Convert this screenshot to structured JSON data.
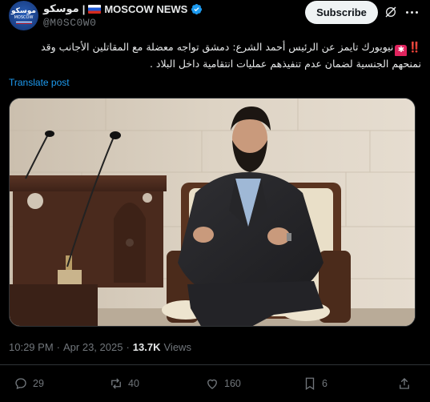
{
  "author": {
    "name_arabic": "موسكو",
    "separator": "|",
    "name_english": "MOSCOW NEWS",
    "handle": "@M0SC0W0",
    "avatar_text_top": "موسكو",
    "avatar_text_bottom": "MOSCOW"
  },
  "header": {
    "subscribe_label": "Subscribe"
  },
  "tweet": {
    "emoji_prefix": "‼️",
    "text": "نيويورك تايمز عن الرئيس أحمد الشرع: دمشق تواجه معضلة مع المقاتلين الأجانب وقد نمنحهم الجنسية لضمان عدم تنفيذهم عمليات انتقامية داخل البلاد ."
  },
  "translate_label": "Translate post",
  "meta": {
    "time": "10:29 PM",
    "dot": "·",
    "date": "Apr 23, 2025",
    "views_count": "13.7K",
    "views_label": "Views"
  },
  "actions": {
    "replies": "29",
    "reposts": "40",
    "likes": "160",
    "bookmarks": "6"
  },
  "colors": {
    "background": "#000000",
    "text": "#e7e9ea",
    "muted": "#71767b",
    "link": "#1d9bf0",
    "verified": "#1d9bf0"
  }
}
